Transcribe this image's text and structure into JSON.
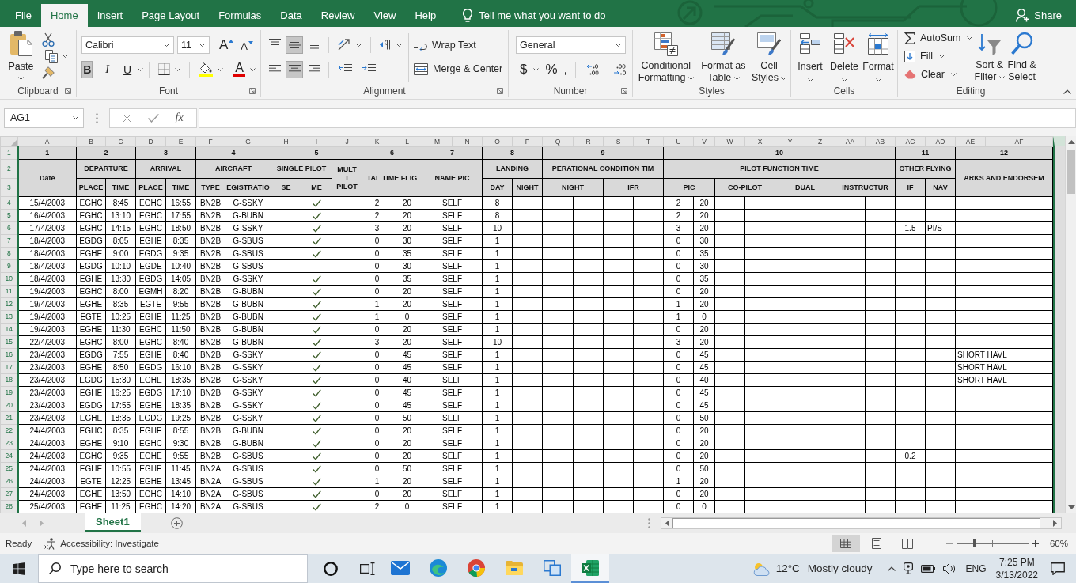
{
  "ribbon_tabs": [
    {
      "label": "File",
      "selected": false
    },
    {
      "label": "Home",
      "selected": true
    },
    {
      "label": "Insert",
      "selected": false
    },
    {
      "label": "Page Layout",
      "selected": false
    },
    {
      "label": "Formulas",
      "selected": false
    },
    {
      "label": "Data",
      "selected": false
    },
    {
      "label": "Review",
      "selected": false
    },
    {
      "label": "View",
      "selected": false
    },
    {
      "label": "Help",
      "selected": false
    }
  ],
  "tell_me": "Tell me what you want to do",
  "share": "Share",
  "ribbon": {
    "clipboard": {
      "title": "Clipboard",
      "paste": "Paste"
    },
    "font": {
      "title": "Font",
      "font_name": "Calibri",
      "font_size": "11",
      "grow": "A",
      "shrink": "A",
      "styles": [
        {
          "label": "B",
          "kind": "bold",
          "selected": true
        },
        {
          "label": "I",
          "kind": "italic",
          "selected": false
        },
        {
          "label": "U",
          "kind": "underline",
          "selected": false
        }
      ],
      "font_color": "A"
    },
    "alignment": {
      "title": "Alignment",
      "vertical": [
        {
          "selected": false
        },
        {
          "selected": true
        },
        {
          "selected": false
        }
      ],
      "horizontal": [
        {
          "selected": false
        },
        {
          "selected": true
        },
        {
          "selected": false
        }
      ],
      "wrap_text": "Wrap Text",
      "merge": "Merge & Center"
    },
    "number": {
      "title": "Number",
      "format": "General",
      "symbols": [
        "$",
        "%",
        ","
      ]
    },
    "styles": {
      "title": "Styles",
      "buttons": [
        "Conditional Formatting",
        "Format as Table",
        "Cell Styles"
      ]
    },
    "cells": {
      "title": "Cells",
      "buttons": [
        "Insert",
        "Delete",
        "Format"
      ]
    },
    "editing": {
      "title": "Editing",
      "small": [
        "AutoSum",
        "Fill",
        "Clear"
      ],
      "large": [
        "Sort & Filter",
        "Find & Select"
      ]
    }
  },
  "formula_bar": {
    "name_box": "AG1",
    "function_label": "fx"
  },
  "sheet": {
    "columns": [
      "A",
      "B",
      "C",
      "D",
      "E",
      "F",
      "G",
      "H",
      "I",
      "J",
      "K",
      "L",
      "M",
      "N",
      "O",
      "P",
      "Q",
      "R",
      "S",
      "T",
      "U",
      "V",
      "W",
      "X",
      "Y",
      "Z",
      "AA",
      "AB",
      "AC",
      "AD",
      "AE",
      "AF"
    ],
    "header_rows": [
      {
        "row": "1",
        "cells": [
          "1",
          "2",
          "3",
          "4",
          "5",
          "6",
          "7",
          "8",
          "9",
          "10",
          "11",
          "12"
        ]
      },
      {
        "row": "2",
        "cells": [
          "Date",
          "DEPARTURE",
          "ARRIVAL",
          "AIRCRAFT",
          "SINGLE PILOT",
          "MULT\nI\nPILOT",
          "TAL TIME FLIG",
          "NAME PIC",
          "LANDING",
          "PERATIONAL CONDITION TIM",
          "PILOT FUNCTION TIME",
          "OTHER FLYING",
          "ARKS AND ENDORSEM"
        ]
      },
      {
        "row": "3",
        "cells": [
          "PLACE",
          "TIME",
          "PLACE",
          "TIME",
          "TYPE",
          "EGISTRATIO",
          "SE",
          "ME",
          "DAY",
          "NIGHT",
          "NIGHT",
          "IFR",
          "PIC",
          "CO-PILOT",
          "DUAL",
          "INSTRUCTUR",
          "IF",
          "NAV"
        ]
      }
    ],
    "rows": [
      {
        "row": "4",
        "date": "15/4/2003",
        "departure_place": "EGHC",
        "departure_time": "8:45",
        "arrival_place": "EGHC",
        "arrival_time": "16:55",
        "aircraft_type": "BN2B",
        "registration": "G-SSKY",
        "multi_engine": true,
        "total_hours": "2",
        "total_minutes": "20",
        "name_pic": "SELF",
        "landing_day": "8",
        "pic_hours": "2",
        "pic_minutes": "20"
      },
      {
        "row": "5",
        "date": "16/4/2003",
        "departure_place": "EGHC",
        "departure_time": "13:10",
        "arrival_place": "EGHC",
        "arrival_time": "17:55",
        "aircraft_type": "BN2B",
        "registration": "G-BUBN",
        "multi_engine": true,
        "total_hours": "2",
        "total_minutes": "20",
        "name_pic": "SELF",
        "landing_day": "8",
        "pic_hours": "2",
        "pic_minutes": "20"
      },
      {
        "row": "6",
        "date": "17/4/2003",
        "departure_place": "EGHC",
        "departure_time": "14:15",
        "arrival_place": "EGHC",
        "arrival_time": "18:50",
        "aircraft_type": "BN2B",
        "registration": "G-SSKY",
        "multi_engine": true,
        "total_hours": "3",
        "total_minutes": "20",
        "name_pic": "SELF",
        "landing_day": "10",
        "pic_hours": "3",
        "pic_minutes": "20",
        "if": "1.5",
        "nav": "PI/S"
      },
      {
        "row": "7",
        "date": "18/4/2003",
        "departure_place": "EGDG",
        "departure_time": "8:05",
        "arrival_place": "EGHE",
        "arrival_time": "8:35",
        "aircraft_type": "BN2B",
        "registration": "G-SBUS",
        "multi_engine": true,
        "total_hours": "0",
        "total_minutes": "30",
        "name_pic": "SELF",
        "landing_day": "1",
        "pic_hours": "0",
        "pic_minutes": "30"
      },
      {
        "row": "8",
        "date": "18/4/2003",
        "departure_place": "EGHE",
        "departure_time": "9:00",
        "arrival_place": "EGDG",
        "arrival_time": "9:35",
        "aircraft_type": "BN2B",
        "registration": "G-SBUS",
        "multi_engine": true,
        "total_hours": "0",
        "total_minutes": "35",
        "name_pic": "SELF",
        "landing_day": "1",
        "pic_hours": "0",
        "pic_minutes": "35"
      },
      {
        "row": "9",
        "date": "18/4/2003",
        "departure_place": "EGDG",
        "departure_time": "10:10",
        "arrival_place": "EGDE",
        "arrival_time": "10:40",
        "aircraft_type": "BN2B",
        "registration": "G-SBUS",
        "multi_engine": false,
        "total_hours": "0",
        "total_minutes": "30",
        "name_pic": "SELF",
        "landing_day": "1",
        "pic_hours": "0",
        "pic_minutes": "30"
      },
      {
        "row": "10",
        "date": "18/4/2003",
        "departure_place": "EGHE",
        "departure_time": "13:30",
        "arrival_place": "EGDG",
        "arrival_time": "14:05",
        "aircraft_type": "BN2B",
        "registration": "G-SSKY",
        "multi_engine": true,
        "total_hours": "0",
        "total_minutes": "35",
        "name_pic": "SELF",
        "landing_day": "1",
        "pic_hours": "0",
        "pic_minutes": "35"
      },
      {
        "row": "11",
        "date": "19/4/2003",
        "departure_place": "EGHC",
        "departure_time": "8:00",
        "arrival_place": "EGMH",
        "arrival_time": "8:20",
        "aircraft_type": "BN2B",
        "registration": "G-BUBN",
        "multi_engine": true,
        "total_hours": "0",
        "total_minutes": "20",
        "name_pic": "SELF",
        "landing_day": "1",
        "pic_hours": "0",
        "pic_minutes": "20"
      },
      {
        "row": "12",
        "date": "19/4/2003",
        "departure_place": "EGHE",
        "departure_time": "8:35",
        "arrival_place": "EGTE",
        "arrival_time": "9:55",
        "aircraft_type": "BN2B",
        "registration": "G-BUBN",
        "multi_engine": true,
        "total_hours": "1",
        "total_minutes": "20",
        "name_pic": "SELF",
        "landing_day": "1",
        "pic_hours": "1",
        "pic_minutes": "20"
      },
      {
        "row": "13",
        "date": "19/4/2003",
        "departure_place": "EGTE",
        "departure_time": "10:25",
        "arrival_place": "EGHE",
        "arrival_time": "11:25",
        "aircraft_type": "BN2B",
        "registration": "G-BUBN",
        "multi_engine": true,
        "total_hours": "1",
        "total_minutes": "0",
        "name_pic": "SELF",
        "landing_day": "1",
        "pic_hours": "1",
        "pic_minutes": "0"
      },
      {
        "row": "14",
        "date": "19/4/2003",
        "departure_place": "EGHE",
        "departure_time": "11:30",
        "arrival_place": "EGHC",
        "arrival_time": "11:50",
        "aircraft_type": "BN2B",
        "registration": "G-BUBN",
        "multi_engine": true,
        "total_hours": "0",
        "total_minutes": "20",
        "name_pic": "SELF",
        "landing_day": "1",
        "pic_hours": "0",
        "pic_minutes": "20"
      },
      {
        "row": "15",
        "date": "22/4/2003",
        "departure_place": "EGHC",
        "departure_time": "8:00",
        "arrival_place": "EGHC",
        "arrival_time": "8:40",
        "aircraft_type": "BN2B",
        "registration": "G-BUBN",
        "multi_engine": true,
        "total_hours": "3",
        "total_minutes": "20",
        "name_pic": "SELF",
        "landing_day": "10",
        "pic_hours": "3",
        "pic_minutes": "20"
      },
      {
        "row": "16",
        "date": "23/4/2003",
        "departure_place": "EGDG",
        "departure_time": "7:55",
        "arrival_place": "EGHE",
        "arrival_time": "8:40",
        "aircraft_type": "BN2B",
        "registration": "G-SSKY",
        "multi_engine": true,
        "total_hours": "0",
        "total_minutes": "45",
        "name_pic": "SELF",
        "landing_day": "1",
        "pic_hours": "0",
        "pic_minutes": "45",
        "remarks": "SHORT HAVL"
      },
      {
        "row": "17",
        "date": "23/4/2003",
        "departure_place": "EGHE",
        "departure_time": "8:50",
        "arrival_place": "EGDG",
        "arrival_time": "16:10",
        "aircraft_type": "BN2B",
        "registration": "G-SSKY",
        "multi_engine": true,
        "total_hours": "0",
        "total_minutes": "45",
        "name_pic": "SELF",
        "landing_day": "1",
        "pic_hours": "0",
        "pic_minutes": "45",
        "remarks": "SHORT HAVL"
      },
      {
        "row": "18",
        "date": "23/4/2003",
        "departure_place": "EGDG",
        "departure_time": "15:30",
        "arrival_place": "EGHE",
        "arrival_time": "18:35",
        "aircraft_type": "BN2B",
        "registration": "G-SSKY",
        "multi_engine": true,
        "total_hours": "0",
        "total_minutes": "40",
        "name_pic": "SELF",
        "landing_day": "1",
        "pic_hours": "0",
        "pic_minutes": "40",
        "remarks": "SHORT HAVL"
      },
      {
        "row": "19",
        "date": "23/4/2003",
        "departure_place": "EGHE",
        "departure_time": "16:25",
        "arrival_place": "EGDG",
        "arrival_time": "17:10",
        "aircraft_type": "BN2B",
        "registration": "G-SSKY",
        "multi_engine": true,
        "total_hours": "0",
        "total_minutes": "45",
        "name_pic": "SELF",
        "landing_day": "1",
        "pic_hours": "0",
        "pic_minutes": "45"
      },
      {
        "row": "20",
        "date": "23/4/2003",
        "departure_place": "EGDG",
        "departure_time": "17:55",
        "arrival_place": "EGHE",
        "arrival_time": "18:35",
        "aircraft_type": "BN2B",
        "registration": "G-SSKY",
        "multi_engine": true,
        "total_hours": "0",
        "total_minutes": "45",
        "name_pic": "SELF",
        "landing_day": "1",
        "pic_hours": "0",
        "pic_minutes": "45"
      },
      {
        "row": "21",
        "date": "23/4/2003",
        "departure_place": "EGHE",
        "departure_time": "18:35",
        "arrival_place": "EGDG",
        "arrival_time": "19:25",
        "aircraft_type": "BN2B",
        "registration": "G-SSKY",
        "multi_engine": true,
        "total_hours": "0",
        "total_minutes": "50",
        "name_pic": "SELF",
        "landing_day": "1",
        "pic_hours": "0",
        "pic_minutes": "50"
      },
      {
        "row": "22",
        "date": "24/4/2003",
        "departure_place": "EGHC",
        "departure_time": "8:35",
        "arrival_place": "EGHE",
        "arrival_time": "8:55",
        "aircraft_type": "BN2B",
        "registration": "G-BUBN",
        "multi_engine": true,
        "total_hours": "0",
        "total_minutes": "20",
        "name_pic": "SELF",
        "landing_day": "1",
        "pic_hours": "0",
        "pic_minutes": "20"
      },
      {
        "row": "23",
        "date": "24/4/2003",
        "departure_place": "EGHE",
        "departure_time": "9:10",
        "arrival_place": "EGHC",
        "arrival_time": "9:30",
        "aircraft_type": "BN2B",
        "registration": "G-BUBN",
        "multi_engine": true,
        "total_hours": "0",
        "total_minutes": "20",
        "name_pic": "SELF",
        "landing_day": "1",
        "pic_hours": "0",
        "pic_minutes": "20"
      },
      {
        "row": "24",
        "date": "24/4/2003",
        "departure_place": "EGHC",
        "departure_time": "9:35",
        "arrival_place": "EGHE",
        "arrival_time": "9:55",
        "aircraft_type": "BN2B",
        "registration": "G-SBUS",
        "multi_engine": true,
        "total_hours": "0",
        "total_minutes": "20",
        "name_pic": "SELF",
        "landing_day": "1",
        "pic_hours": "0",
        "pic_minutes": "20",
        "if": "0.2"
      },
      {
        "row": "25",
        "date": "24/4/2003",
        "departure_place": "EGHE",
        "departure_time": "10:55",
        "arrival_place": "EGHE",
        "arrival_time": "11:45",
        "aircraft_type": "BN2A",
        "registration": "G-SBUS",
        "multi_engine": true,
        "total_hours": "0",
        "total_minutes": "50",
        "name_pic": "SELF",
        "landing_day": "1",
        "pic_hours": "0",
        "pic_minutes": "50"
      },
      {
        "row": "26",
        "date": "24/4/2003",
        "departure_place": "EGTE",
        "departure_time": "12:25",
        "arrival_place": "EGHE",
        "arrival_time": "13:45",
        "aircraft_type": "BN2A",
        "registration": "G-SBUS",
        "multi_engine": true,
        "total_hours": "1",
        "total_minutes": "20",
        "name_pic": "SELF",
        "landing_day": "1",
        "pic_hours": "1",
        "pic_minutes": "20"
      },
      {
        "row": "27",
        "date": "24/4/2003",
        "departure_place": "EGHE",
        "departure_time": "13:50",
        "arrival_place": "EGHC",
        "arrival_time": "14:10",
        "aircraft_type": "BN2A",
        "registration": "G-SBUS",
        "multi_engine": true,
        "total_hours": "0",
        "total_minutes": "20",
        "name_pic": "SELF",
        "landing_day": "1",
        "pic_hours": "0",
        "pic_minutes": "20"
      },
      {
        "row": "28",
        "date": "25/4/2003",
        "departure_place": "EGHE",
        "departure_time": "11:25",
        "arrival_place": "EGHC",
        "arrival_time": "14:20",
        "aircraft_type": "BN2A",
        "registration": "G-SBUS",
        "multi_engine": true,
        "total_hours": "2",
        "total_minutes": "0",
        "name_pic": "SELF",
        "landing_day": "1",
        "pic_hours": "0",
        "pic_minutes": "0"
      }
    ]
  },
  "sheet_tabs": [
    {
      "label": "Sheet1",
      "selected": true
    }
  ],
  "status_bar": {
    "mode": "Ready",
    "accessibility": "Accessibility: Investigate",
    "views": [
      {
        "selected": true
      },
      {
        "selected": false
      },
      {
        "selected": false
      }
    ],
    "zoom": {
      "level": 0.25,
      "reading": "60%"
    }
  },
  "taskbar": {
    "search": {
      "placeholder": "Type here to search"
    },
    "apps": [
      {
        "selected": false
      },
      {
        "selected": false
      },
      {
        "selected": false
      },
      {
        "selected": false
      },
      {
        "selected": false
      },
      {
        "selected": true
      }
    ],
    "weather": {
      "temperature": "12°C",
      "condition": "Mostly cloudy"
    },
    "language": "ENG",
    "time": "7:25 PM",
    "date": "3/13/2022"
  }
}
